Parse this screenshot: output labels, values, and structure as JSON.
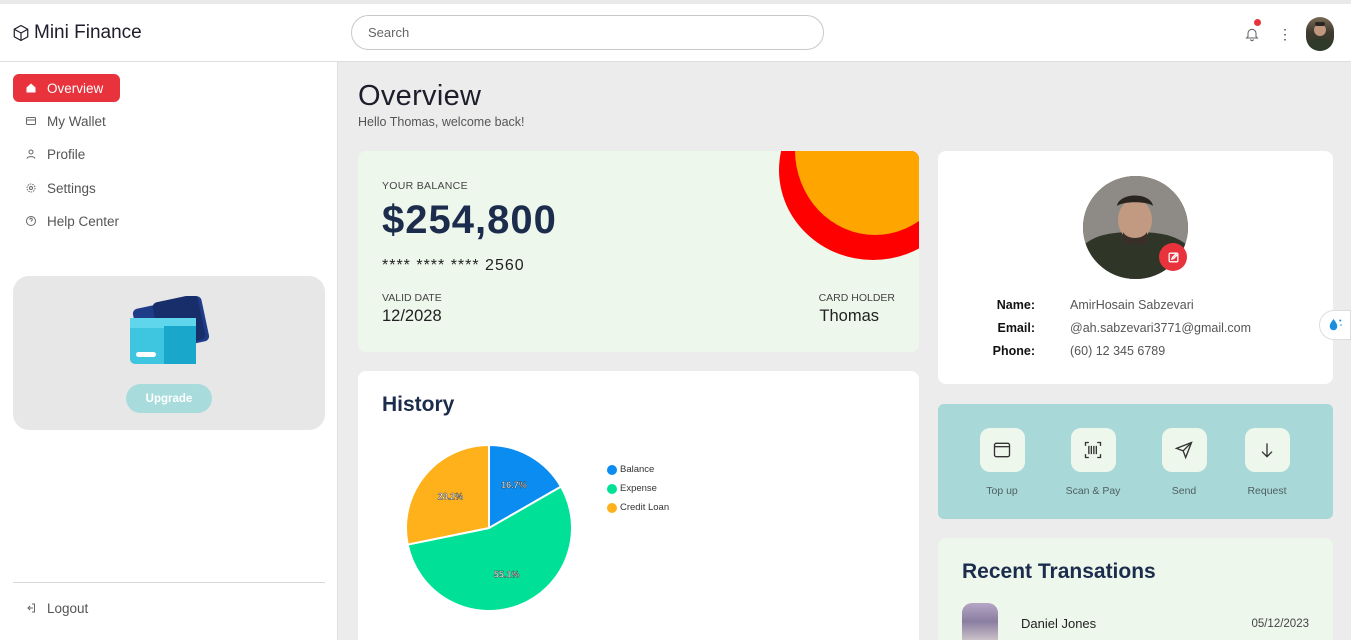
{
  "app": {
    "title": "Mini Finance"
  },
  "search": {
    "placeholder": "Search"
  },
  "sidebar": {
    "items": [
      {
        "label": "Overview",
        "icon": "home-icon",
        "active": true
      },
      {
        "label": "My Wallet",
        "icon": "wallet-icon",
        "active": false
      },
      {
        "label": "Profile",
        "icon": "user-icon",
        "active": false
      },
      {
        "label": "Settings",
        "icon": "gear-icon",
        "active": false
      },
      {
        "label": "Help Center",
        "icon": "help-icon",
        "active": false
      }
    ],
    "upgrade_label": "Upgrade",
    "logout_label": "Logout"
  },
  "page": {
    "title": "Overview",
    "subtitle": "Hello Thomas, welcome back!"
  },
  "balance": {
    "label": "YOUR BALANCE",
    "amount": "$254,800",
    "card_number": "**** **** **** 2560",
    "valid_label": "VALID DATE",
    "valid_value": "12/2028",
    "holder_label": "CARD HOLDER",
    "holder_value": "Thomas"
  },
  "history": {
    "title": "History"
  },
  "chart_data": {
    "type": "pie",
    "title": "History",
    "categories": [
      "Balance",
      "Expense",
      "Credit Loan"
    ],
    "values": [
      16.7,
      55.1,
      28.2
    ],
    "labels": [
      "16.7%",
      "55.1%",
      "28.2%"
    ],
    "colors": [
      "#0a8cf0",
      "#00e096",
      "#ffb11b"
    ],
    "legend": "right"
  },
  "profile": {
    "name_label": "Name:",
    "name_value": "AmirHosain Sabzevari",
    "email_label": "Email:",
    "email_value": "@ah.sabzevari3771@gmail.com",
    "phone_label": "Phone:",
    "phone_value": "(60) 12 345 6789"
  },
  "actions": [
    {
      "label": "Top up",
      "icon": "wallet-icon"
    },
    {
      "label": "Scan & Pay",
      "icon": "barcode-scan-icon"
    },
    {
      "label": "Send",
      "icon": "send-icon"
    },
    {
      "label": "Request",
      "icon": "arrow-down-icon"
    }
  ],
  "transactions": {
    "title": "Recent Transations",
    "items": [
      {
        "name": "Daniel Jones",
        "date": "05/12/2023"
      }
    ]
  },
  "colors": {
    "accent": "#e8333c",
    "navy": "#1c2c4c",
    "teal": "#a9d8d8",
    "mint": "#eef7ec"
  }
}
